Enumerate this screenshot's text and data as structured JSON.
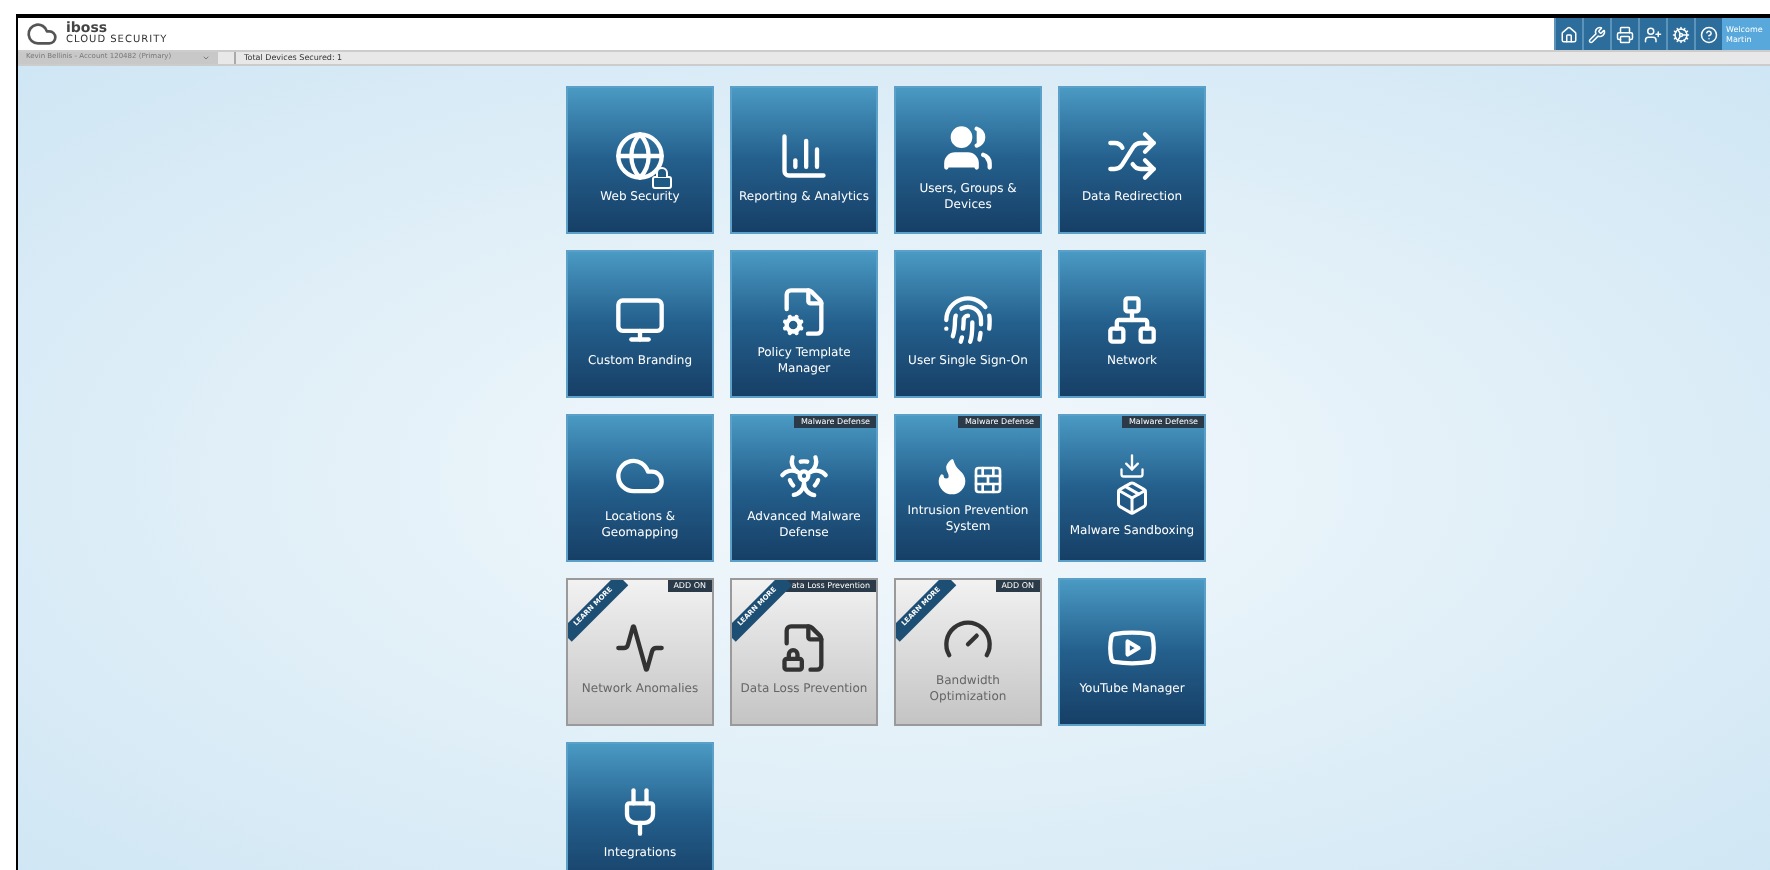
{
  "header": {
    "logo_name": "iboss",
    "logo_subtitle": "CLOUD SECURITY",
    "toolbar": [
      {
        "kind": "home"
      },
      {
        "kind": "wrench"
      },
      {
        "kind": "printer"
      },
      {
        "kind": "user-plus"
      },
      {
        "kind": "cogs"
      },
      {
        "kind": "help"
      }
    ],
    "welcome": [
      "Welcome",
      "Martin"
    ]
  },
  "subbar": {
    "account_select": "Kevin Bellinis - Account 120482 (Primary)",
    "devices": "Total Devices Secured: 1"
  },
  "tiles": [
    {
      "label": "Web Security",
      "kind": "normal"
    },
    {
      "label": "Reporting & Analytics",
      "kind": "normal"
    },
    {
      "label": "Users, Groups & Devices",
      "kind": "normal"
    },
    {
      "label": "Data Redirection",
      "kind": "normal"
    },
    {
      "label": "Custom Branding",
      "kind": "normal"
    },
    {
      "label": "Policy Template Manager",
      "kind": "normal"
    },
    {
      "label": "User Single Sign-On",
      "kind": "normal"
    },
    {
      "label": "Network",
      "kind": "normal"
    },
    {
      "label": "Locations & Geomapping",
      "kind": "normal"
    },
    {
      "label": "Advanced Malware Defense",
      "kind": "normal",
      "badge": "Malware Defense"
    },
    {
      "label": "Intrusion Prevention System",
      "kind": "normal",
      "badge": "Malware Defense"
    },
    {
      "label": "Malware Sandboxing",
      "kind": "normal",
      "badge": "Malware Defense"
    },
    {
      "label": "Network Anomalies",
      "kind": "addon",
      "badge": "ADD ON",
      "ribbon": "LEARN MORE"
    },
    {
      "label": "Data Loss Prevention",
      "kind": "addon",
      "badge": "ata Loss Prevention",
      "ribbon": "LEARN MORE"
    },
    {
      "label": "Bandwidth Optimization",
      "kind": "addon",
      "badge": "ADD ON",
      "ribbon": "LEARN MORE"
    },
    {
      "label": "YouTube Manager",
      "kind": "normal"
    },
    {
      "label": "Integrations",
      "kind": "normal"
    }
  ]
}
